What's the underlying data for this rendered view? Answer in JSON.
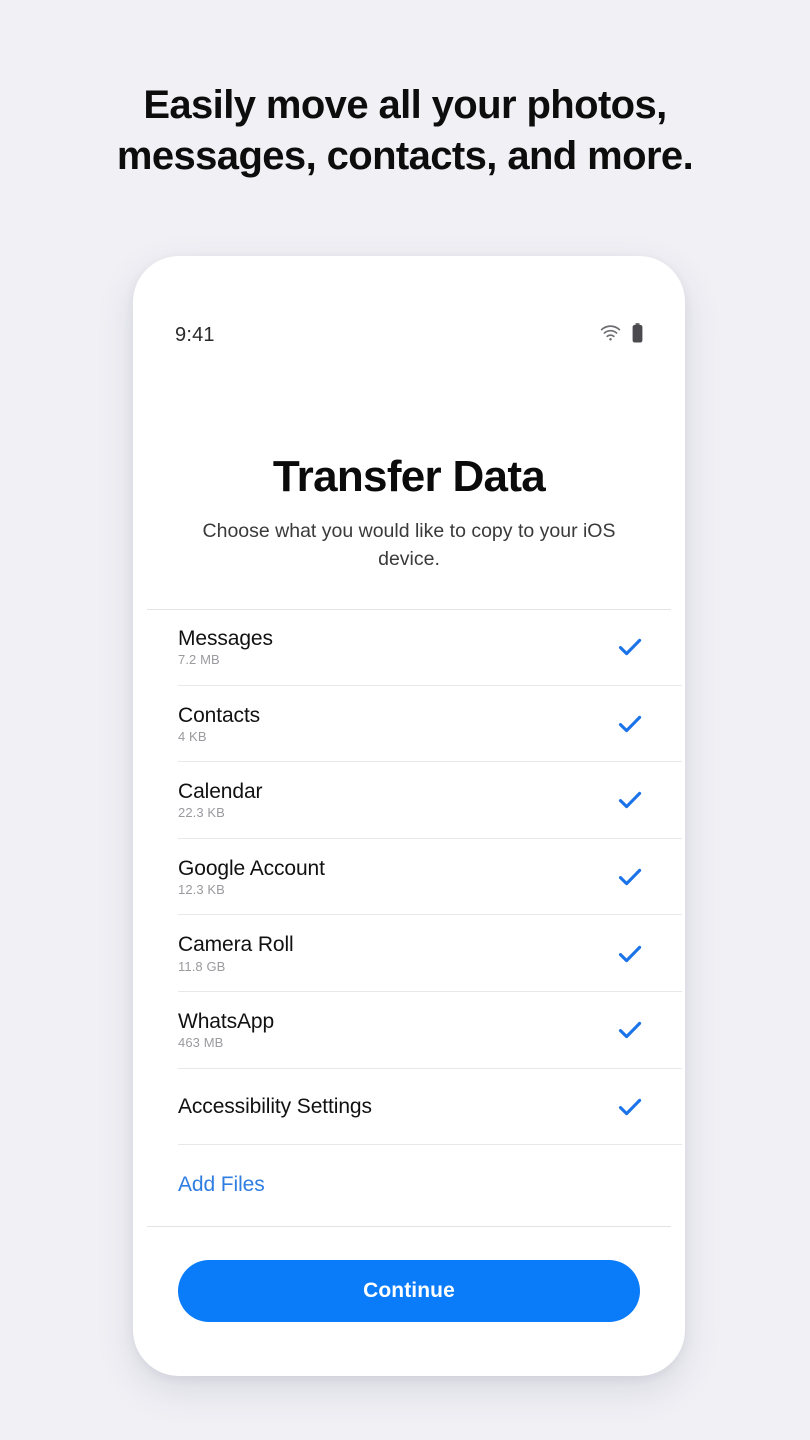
{
  "headline": {
    "line1": "Easily move all your photos,",
    "line2": "messages, contacts, and more."
  },
  "phone": {
    "status_bar": {
      "time": "9:41",
      "wifi_icon": "wifi-icon",
      "battery_icon": "battery-full-icon"
    },
    "screen": {
      "title": "Transfer Data",
      "subtitle": "Choose what you would like to copy to your iOS device.",
      "items": [
        {
          "label": "Messages",
          "size": "7.2 MB",
          "checked": true
        },
        {
          "label": "Contacts",
          "size": "4 KB",
          "checked": true
        },
        {
          "label": "Calendar",
          "size": "22.3 KB",
          "checked": true
        },
        {
          "label": "Google Account",
          "size": "12.3 KB",
          "checked": true
        },
        {
          "label": "Camera Roll",
          "size": "11.8 GB",
          "checked": true
        },
        {
          "label": "WhatsApp",
          "size": "463 MB",
          "checked": true
        },
        {
          "label": "Accessibility Settings",
          "size": "",
          "checked": true
        }
      ],
      "add_files_label": "Add Files",
      "continue_label": "Continue"
    }
  },
  "colors": {
    "page_background": "#f0f0f5",
    "accent_blue": "#0a7cfa",
    "link_blue": "#2f7de1",
    "check_blue": "#1a73e8",
    "text_primary": "#111111",
    "text_secondary": "#9a9a9f",
    "divider": "#e8e8ec"
  }
}
